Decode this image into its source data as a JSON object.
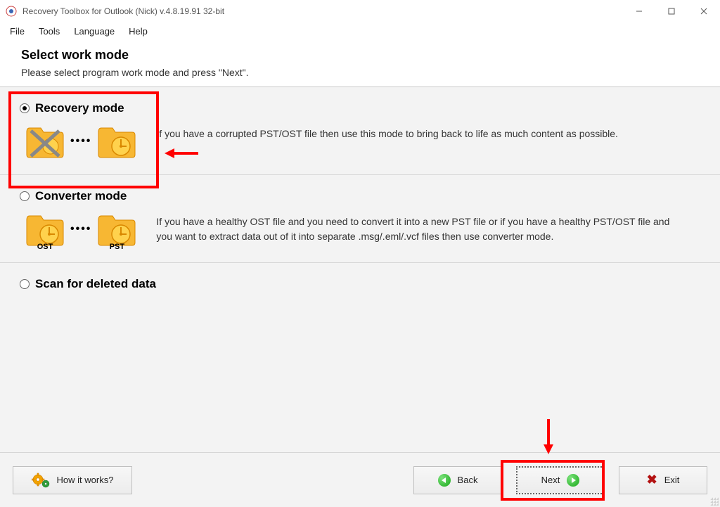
{
  "window": {
    "title": "Recovery Toolbox for Outlook (Nick) v.4.8.19.91 32-bit"
  },
  "menu": {
    "file": "File",
    "tools": "Tools",
    "language": "Language",
    "help": "Help"
  },
  "header": {
    "title": "Select work mode",
    "subtitle": "Please select program work mode and press \"Next\"."
  },
  "options": {
    "recovery": {
      "label": "Recovery mode",
      "selected": true,
      "description": "If you have a corrupted PST/OST file then use this mode to bring back to life as much content as possible."
    },
    "converter": {
      "label": "Converter mode",
      "selected": false,
      "description": "If you have a healthy OST file and you need to convert it into a new PST file or if you have a healthy PST/OST file and you want to extract data out of it into separate .msg/.eml/.vcf files then use converter mode.",
      "src_label": "OST",
      "dst_label": "PST"
    },
    "scan": {
      "label": "Scan for deleted data",
      "selected": false
    }
  },
  "footer": {
    "how_it_works": "How it works?",
    "back": "Back",
    "next": "Next",
    "exit": "Exit"
  },
  "annotations": {
    "highlight_recovery": true,
    "highlight_next": true
  }
}
